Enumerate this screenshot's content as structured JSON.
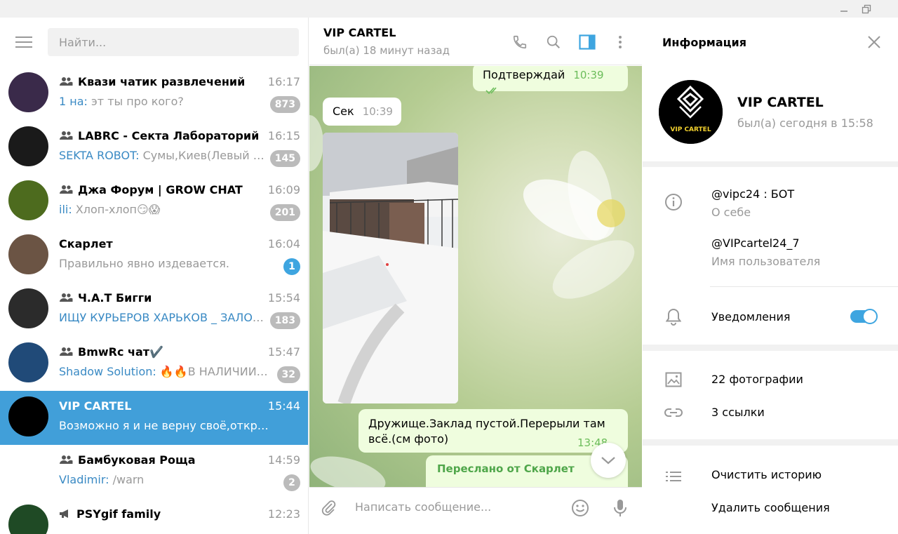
{
  "window": {
    "minimize_icon": "minimize-icon",
    "restore_icon": "restore-icon"
  },
  "sidebar": {
    "search_placeholder": "Найти...",
    "chats": [
      {
        "name": "Квази чатик развлечений",
        "type": "group",
        "time": "16:17",
        "sender": "1 на:",
        "preview": " эт ты про кого?",
        "unread": "873",
        "badge_color": "gray",
        "avatar_color": "#3a2a4a"
      },
      {
        "name": "LABRC - Секта Лабораторий",
        "type": "group",
        "time": "16:15",
        "sender": "SEKTA ROBOT:",
        "preview": " Сумы,Киев(Левый бер...",
        "unread": "145",
        "badge_color": "gray",
        "avatar_color": "#1a1a1a"
      },
      {
        "name": "Джа Форум | GROW CHAT",
        "type": "group",
        "time": "16:09",
        "sender": "ili:",
        "preview": " Хлоп-хлоп😏😱",
        "unread": "201",
        "badge_color": "gray",
        "avatar_color": "#4d6b1e"
      },
      {
        "name": "Скарлет",
        "type": "private",
        "time": "16:04",
        "sender": "",
        "preview": "Правильно явно издевается.",
        "unread": "1",
        "badge_color": "blue",
        "avatar_color": "#6b5444"
      },
      {
        "name": "Ч.А.Т Бигги",
        "type": "group",
        "time": "15:54",
        "sender": "ИЩУ КУРЬЕРОВ ХАРЬКОВ _ ЗАЛОГ!!: ...",
        "preview": "",
        "unread": "183",
        "badge_color": "gray",
        "avatar_color": "#2b2b2b"
      },
      {
        "name": "BmwRc чат✔️",
        "type": "group",
        "time": "15:47",
        "sender": "Shadow Solution:",
        "preview": " 🔥🔥В НАЛИЧИИ Г...",
        "unread": "32",
        "badge_color": "gray",
        "avatar_color": "#204a78"
      },
      {
        "name": "VIP CARTEL",
        "type": "private",
        "time": "15:44",
        "sender": "",
        "preview": "Возможно я и не верну своё,открыв арбит...",
        "unread": "",
        "badge_color": "",
        "avatar_color": "#000000",
        "active": true
      },
      {
        "name": "Бамбуковая Роща",
        "type": "group",
        "time": "14:59",
        "sender": "Vladimir:",
        "preview": " /warn",
        "unread": "2",
        "badge_color": "gray",
        "avatar_color": "#ffffff"
      },
      {
        "name": "PSYgif family",
        "type": "channel",
        "time": "12:23",
        "sender": "",
        "preview": "",
        "unread": "",
        "badge_color": "",
        "avatar_color": "#1f4a25"
      }
    ]
  },
  "chat": {
    "title": "VIP CARTEL",
    "status": "был(а) 18 минут назад",
    "messages": {
      "m1": {
        "text": "Подтверждай",
        "time": "10:39"
      },
      "m2": {
        "text": "Сек",
        "time": "10:39"
      },
      "m3": {
        "text": "Дружище.Заклад пустой.Перерыли там всё.(см фото)",
        "time": "13:48"
      },
      "forward": "Переслано от Скарлет"
    },
    "composer_placeholder": "Написать сообщение..."
  },
  "info": {
    "title": "Информация",
    "name": "VIP CARTEL",
    "status": "был(а) сегодня в 15:58",
    "avatar_text": "VIP CARTEL",
    "about": "@vipc24 : БОТ",
    "about_label": "О себе",
    "username": "@VIPcartel24_7",
    "username_label": "Имя пользователя",
    "notifications_label": "Уведомления",
    "notifications_on": true,
    "photos": "22 фотографии",
    "links": "3 ссылки",
    "clear_history": "Очистить историю",
    "delete_messages": "Удалить сообщения"
  }
}
